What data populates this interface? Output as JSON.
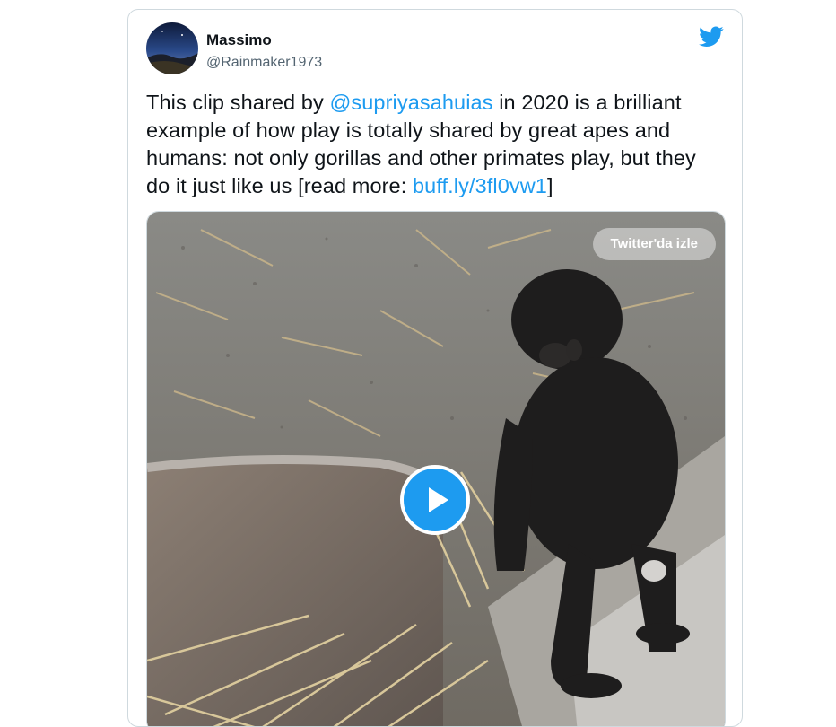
{
  "tweet": {
    "author_name": "Massimo",
    "author_handle": "@Rainmaker1973",
    "text_part1": "This clip shared by ",
    "mention": "@supriyasahuias",
    "text_part2": " in 2020 is a brilliant example of how play is totally shared by great apes and humans: not only gorillas and other primates play, but they do it just like us [read more: ",
    "short_link": "buff.ly/3fl0vw1",
    "text_part3": "]"
  },
  "media": {
    "watch_label": "Twitter'da izle",
    "play_icon": "play-icon"
  },
  "icons": {
    "brand": "twitter-bird-icon"
  },
  "colors": {
    "accent": "#1d9bf0",
    "text": "#0f1419",
    "secondary": "#536471"
  }
}
